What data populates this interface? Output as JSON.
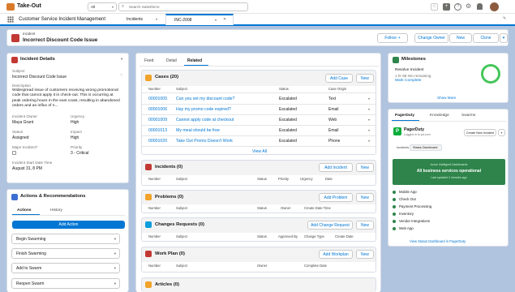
{
  "app": {
    "logo_text": "Take-Out",
    "app_name": "Customer Service Incident Management"
  },
  "global": {
    "scope": "All",
    "search_placeholder": "Search Salesforce"
  },
  "nav": {
    "tab_incidents": "Incidents",
    "tab_record": "INC-2008"
  },
  "record": {
    "object_label": "Incident",
    "title": "Incorrect Discount Code Issue",
    "follow": "Follow",
    "change_owner": "Change Owner",
    "new": "New",
    "clone": "Clone"
  },
  "details": {
    "title": "Incident Details",
    "subject_label": "Subject",
    "subject": "Incorrect Discount Code Issue",
    "description_label": "Description",
    "description": "Widespread issue of customers receiving wrong promotional code that cannot apply it in check-out. This is occurring at peak ordering hours in the east coast, resulting in abandoned orders and an influx of n...",
    "owner_label": "Incident Owner",
    "owner": "Maya Grant",
    "urgency_label": "Urgency",
    "urgency": "High",
    "status_label": "Status",
    "status": "Assigned",
    "impact_label": "Impact",
    "impact": "High",
    "major_label": "Major Incident?",
    "priority_label": "Priority",
    "priority": "3 - Critical",
    "start_label": "Incident Start Date Time",
    "start": "August 31, 8 PM"
  },
  "actions": {
    "title": "Actions & Recommendations",
    "tab_actions": "Actions",
    "tab_history": "History",
    "add_action": "Add Action",
    "steps": [
      "Begin Swarming",
      "Finish Swarming",
      "Add to Swarm",
      "Reopen Swarm"
    ]
  },
  "center": {
    "tabs": [
      "Feed",
      "Detail",
      "Related"
    ],
    "cases": {
      "title": "Cases (20)",
      "add_btn": "Add Case",
      "new_btn": "New",
      "columns": [
        "Number",
        "Subject",
        "Status",
        "Case Origin"
      ],
      "rows": [
        [
          "00001005",
          "Can you set my discount code?",
          "Escalated",
          "Text"
        ],
        [
          "00001006",
          "Hay my promo code expired?",
          "Escalated",
          "Email"
        ],
        [
          "00001009",
          "Cannot apply code at checkout",
          "Escalated",
          "Web"
        ],
        [
          "00001013",
          "My meal should be free",
          "Escalated",
          "Email"
        ],
        [
          "00001020",
          "Take Out Promo Doesn't Work",
          "Escalated",
          "Phone"
        ]
      ],
      "view_all": "View All"
    },
    "incidents": {
      "title": "Incidents (0)",
      "add_btn": "Add Incident",
      "new_btn": "New",
      "columns": [
        "Number",
        "Subject",
        "Status",
        "Priority",
        "Urgency",
        "Date"
      ]
    },
    "problems": {
      "title": "Problems (0)",
      "add_btn": "Add Problem",
      "new_btn": "New",
      "columns": [
        "Number",
        "Subject",
        "Status",
        "Owner",
        "Create Date Time"
      ]
    },
    "changes": {
      "title": "Changes Requests (0)",
      "add_btn": "Add Change Request",
      "new_btn": "New",
      "columns": [
        "Number",
        "Subject",
        "Status",
        "Approved By",
        "Change Type",
        "Create Date"
      ]
    },
    "workplan": {
      "title": "Work Plan (0)",
      "add_btn": "Add Workplan",
      "new_btn": "New",
      "columns": [
        "Number",
        "Subject",
        "Owner",
        "Complete Date"
      ]
    },
    "articles": {
      "title": "Articles (0)"
    }
  },
  "milestones": {
    "title": "Milestones",
    "name": "Resolve Incident",
    "sub": "1 hr 58 min remaining",
    "link": "Mark Complete",
    "show_more": "Show More"
  },
  "pagerduty": {
    "tabs": [
      "PagerDuty",
      "Knowledge",
      "Swarms"
    ],
    "name": "PagerDuty",
    "sub": "Logged in to pd.com",
    "create_btn": "Create New Incident",
    "subtabs": [
      "Incidents",
      "Status Dashboard"
    ],
    "banner_small": "Acme Intelligent Dashboards",
    "banner": "All business services operational",
    "banner_sub": "Last updated 2 minutes ago",
    "services": [
      "Mobile App",
      "Check Out",
      "Payment Processing",
      "Inventory",
      "Vendor Integrations",
      "Web App"
    ],
    "link": "View Status Dashboard in PagerDuty"
  },
  "colors": {
    "brand": "#0176d3",
    "success": "#2e844a",
    "ring": "#45c65a",
    "bg": "#b0c4df"
  }
}
